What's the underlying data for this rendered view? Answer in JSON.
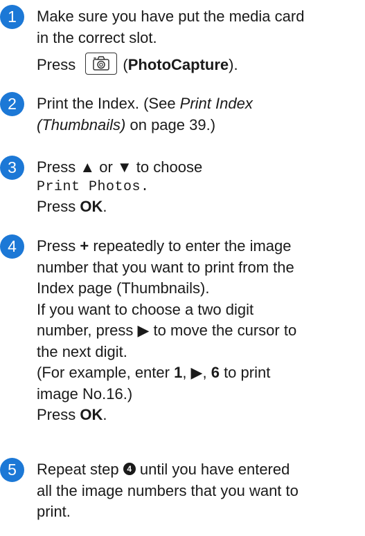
{
  "steps": [
    {
      "number": "1",
      "line1": "Make sure you have put the media card",
      "line2": "in the correct slot.",
      "press": "Press",
      "button_label": "PhotoCapture",
      "button_icon": "camera-icon",
      "paren_open": "(",
      "paren_close": ")."
    },
    {
      "number": "2",
      "line1_prefix": "Print the Index. (See ",
      "line1_link": "Print Index",
      "line2_link": "(Thumbnails)",
      "line2_suffix": " on page 39.)"
    },
    {
      "number": "3",
      "line1": "Press ▲ or ▼ to choose",
      "line2_lcd": "Print Photos.",
      "line3_prefix": "Press ",
      "line3_key": "OK",
      "line3_suffix": "."
    },
    {
      "number": "4",
      "line1_prefix": "Press ",
      "line1_key": "+",
      "line1_suffix": " repeatedly to enter the image",
      "line2": "number that you want to print from the",
      "line3": "Index page (Thumbnails).",
      "line4": "If you want to choose a two digit",
      "line5": "number, press ▶ to move the cursor to",
      "line6": "the next digit.",
      "line7_prefix": "(For example, enter ",
      "line7_key1": "1",
      "line7_mid1": ", ▶, ",
      "line7_key2": "6",
      "line7_suffix": " to print",
      "line8": "image No.16.)",
      "line9_prefix": "Press ",
      "line9_key": "OK",
      "line9_suffix": "."
    },
    {
      "number": "5",
      "line1_prefix": "Repeat step ",
      "line1_ref": "4",
      "line1_suffix": " until you have entered",
      "line2": "all the image numbers that you want to",
      "line3": "print."
    }
  ],
  "colors": {
    "badge": "#1c78d6",
    "text": "#1a1a1a"
  }
}
